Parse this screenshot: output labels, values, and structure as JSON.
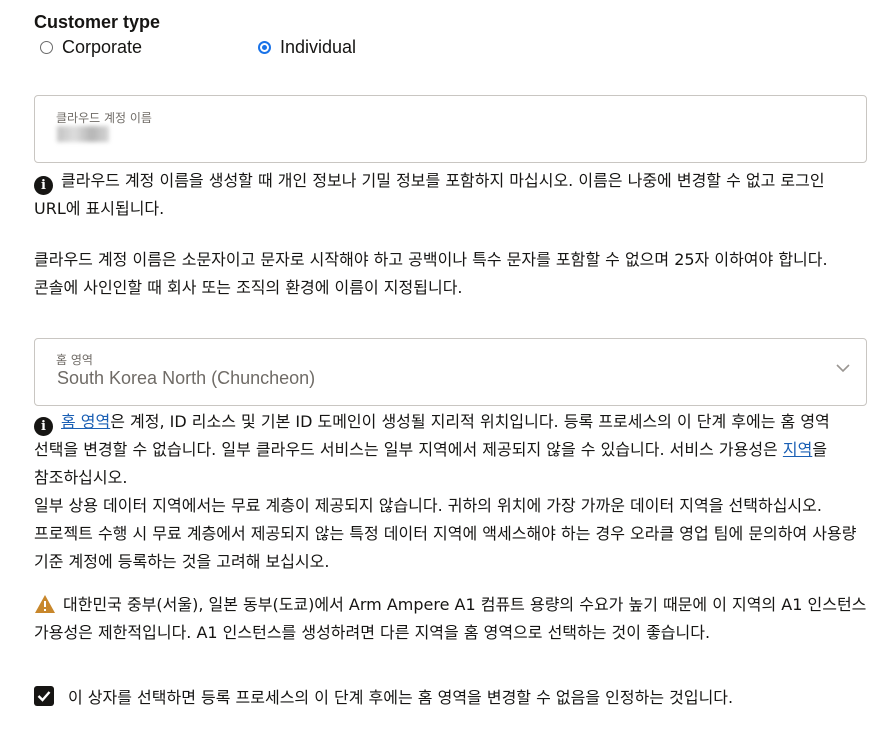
{
  "customer_type": {
    "title": "Customer type",
    "options": [
      {
        "label": "Corporate",
        "selected": false
      },
      {
        "label": "Individual",
        "selected": true
      }
    ]
  },
  "cloud_account": {
    "label": "클라우드 계정 이름",
    "value_redacted": true,
    "info_text": "클라우드 계정 이름을 생성할 때 개인 정보나 기밀 정보를 포함하지 마십시오. 이름은 나중에 변경할 수 없고 로그인 URL에 표시됩니다.",
    "rules_text": "클라우드 계정 이름은 소문자이고 문자로 시작해야 하고 공백이나 특수 문자를 포함할 수 없으며 25자 이하여야 합니다. 콘솔에 사인인할 때 회사 또는 조직의 환경에 이름이 지정됩니다."
  },
  "home_region": {
    "label": "홈 영역",
    "value": "South Korea North (Chuncheon)",
    "info_link": "홈 영역",
    "info_text_1": "은 계정, ID 리소스 및 기본 ID 도메인이 생성될 지리적 위치입니다. 등록 프로세스의 이 단계 후에는 홈 영역 선택을 변경할 수 없습니다. 일부 클라우드 서비스는 일부 지역에서 제공되지 않을 수 있습니다. 서비스 가용성은 ",
    "regions_link": "지역",
    "info_text_2": "을 참조하십시오.",
    "free_tier_text": "일부 상용 데이터 지역에서는 무료 계층이 제공되지 않습니다. 귀하의 위치에 가장 가까운 데이터 지역을 선택하십시오. 프로젝트 수행 시 무료 계층에서 제공되지 않는 특정 데이터 지역에 액세스해야 하는 경우 오라클 영업 팀에 문의하여 사용량 기준 계정에 등록하는 것을 고려해 보십시오.",
    "warning_text": "대한민국 중부(서울), 일본 동부(도쿄)에서 Arm Ampere A1 컴퓨트 용량의 수요가 높기 때문에 이 지역의 A1 인스턴스 가용성은 제한적입니다. A1 인스턴스를 생성하려면 다른 지역을 홈 영역으로 선택하는 것이 좋습니다."
  },
  "acknowledge": {
    "checked": true,
    "label": "이 상자를 선택하면 등록 프로세스의 이 단계 후에는 홈 영역을 변경할 수 없음을 인정하는 것입니다."
  },
  "colors": {
    "link": "#1a5fb4",
    "radio_selected": "#1a73e8",
    "warning": "#c8872b",
    "text": "#161513"
  },
  "icons": [
    "info-icon",
    "warning-icon",
    "chevron-down-icon",
    "checkmark-icon"
  ]
}
